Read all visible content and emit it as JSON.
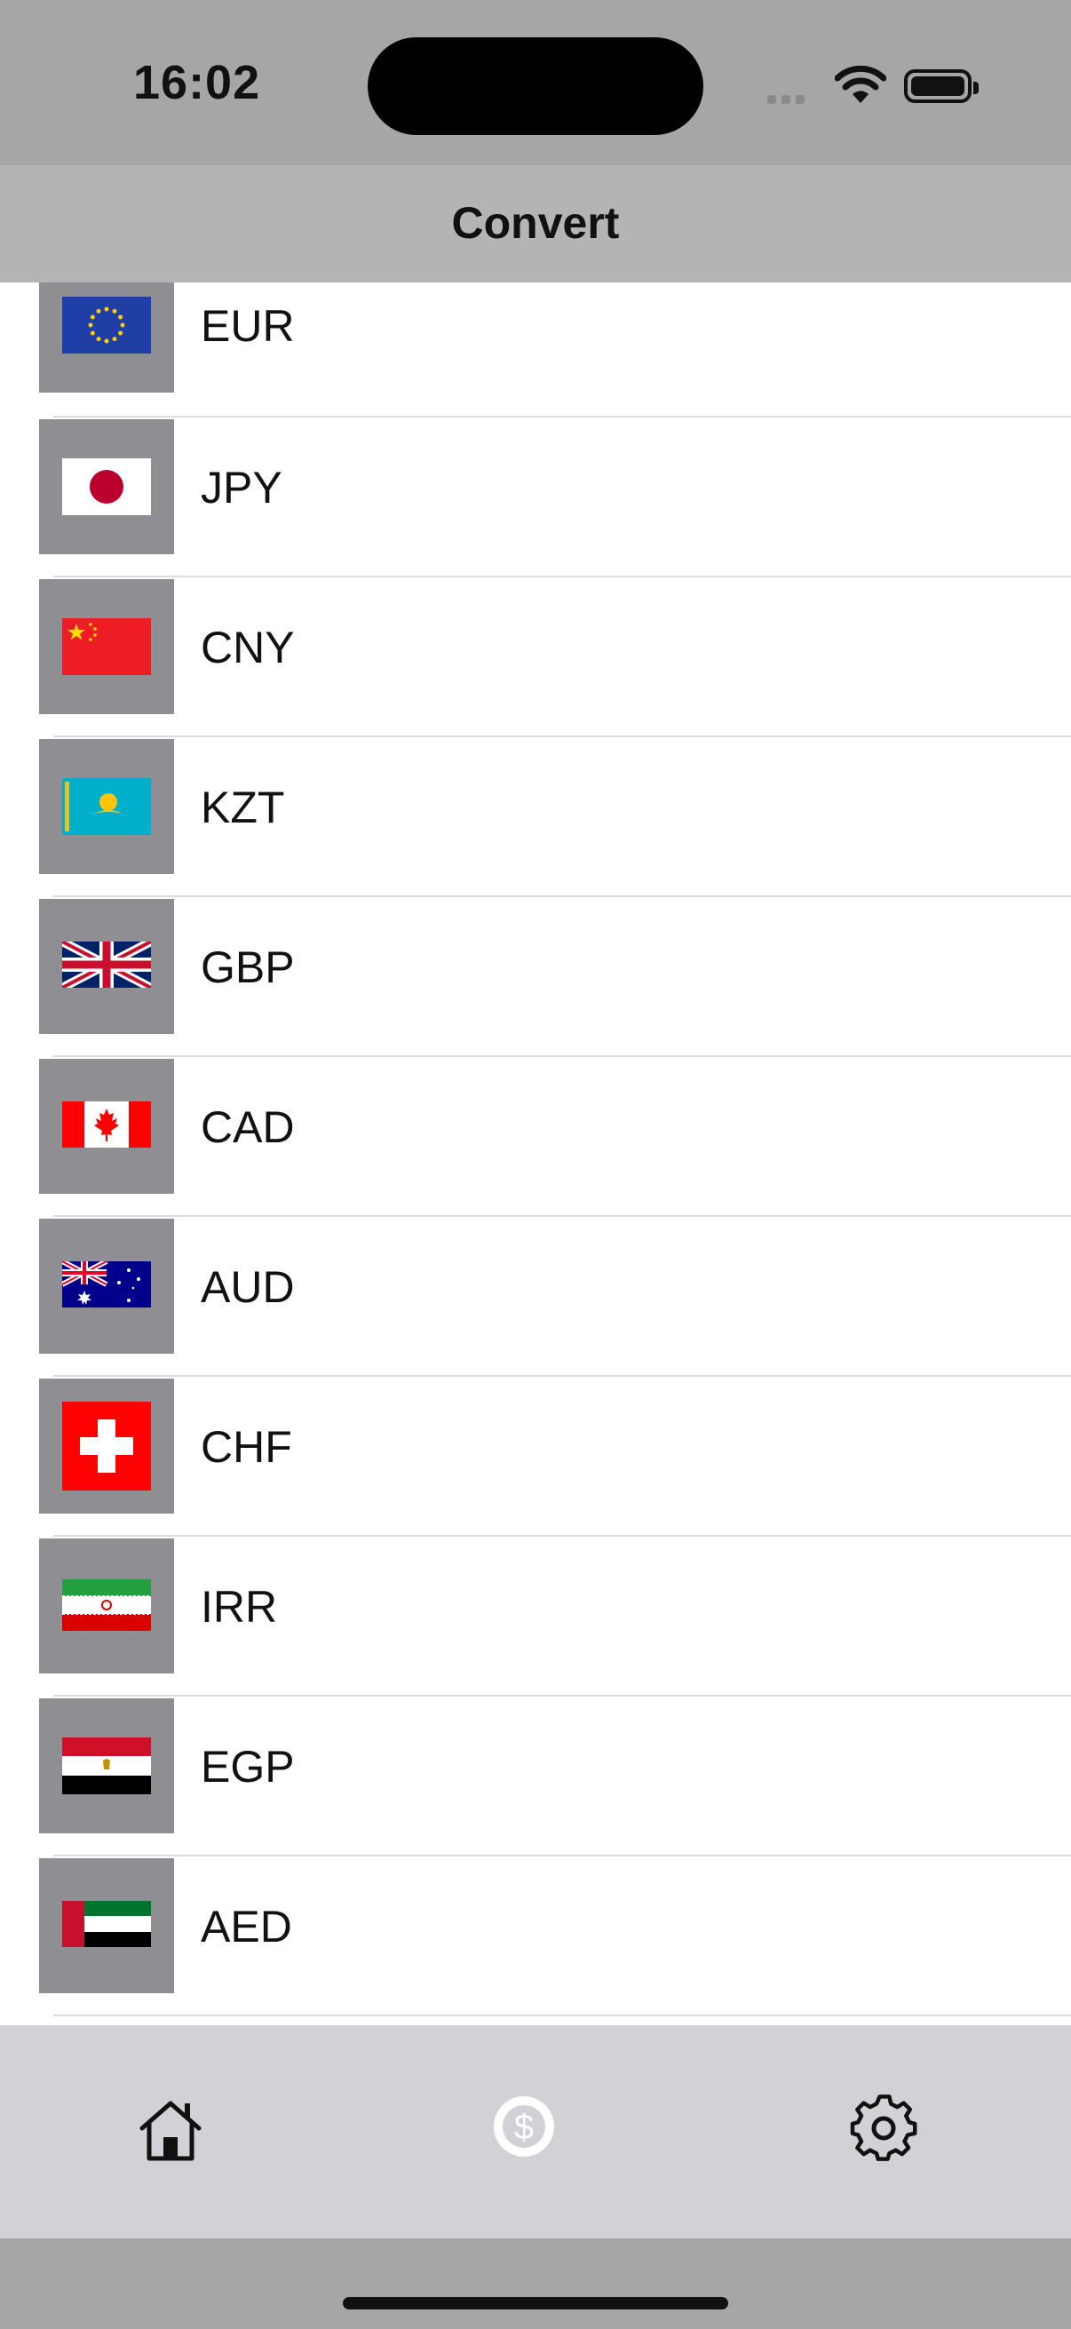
{
  "status_bar": {
    "time": "16:02"
  },
  "nav": {
    "title": "Convert"
  },
  "currencies": [
    {
      "code": "EUR",
      "flag_icon": "eu-flag-icon"
    },
    {
      "code": "JPY",
      "flag_icon": "japan-flag-icon"
    },
    {
      "code": "CNY",
      "flag_icon": "china-flag-icon"
    },
    {
      "code": "KZT",
      "flag_icon": "kazakhstan-flag-icon"
    },
    {
      "code": "GBP",
      "flag_icon": "uk-flag-icon"
    },
    {
      "code": "CAD",
      "flag_icon": "canada-flag-icon"
    },
    {
      "code": "AUD",
      "flag_icon": "australia-flag-icon"
    },
    {
      "code": "CHF",
      "flag_icon": "switzerland-flag-icon"
    },
    {
      "code": "IRR",
      "flag_icon": "iran-flag-icon"
    },
    {
      "code": "EGP",
      "flag_icon": "egypt-flag-icon"
    },
    {
      "code": "AED",
      "flag_icon": "uae-flag-icon"
    }
  ],
  "tabs": [
    {
      "icon": "home-icon",
      "selected": false
    },
    {
      "icon": "dollar-circle-icon",
      "selected": true
    },
    {
      "icon": "gear-icon",
      "selected": false
    }
  ],
  "colors": {
    "status_bg": "#a6a6a6",
    "nav_bg": "#b4b4b4",
    "thumb_bg": "#8e8e93",
    "tab_bg": "#d2d2d6"
  }
}
